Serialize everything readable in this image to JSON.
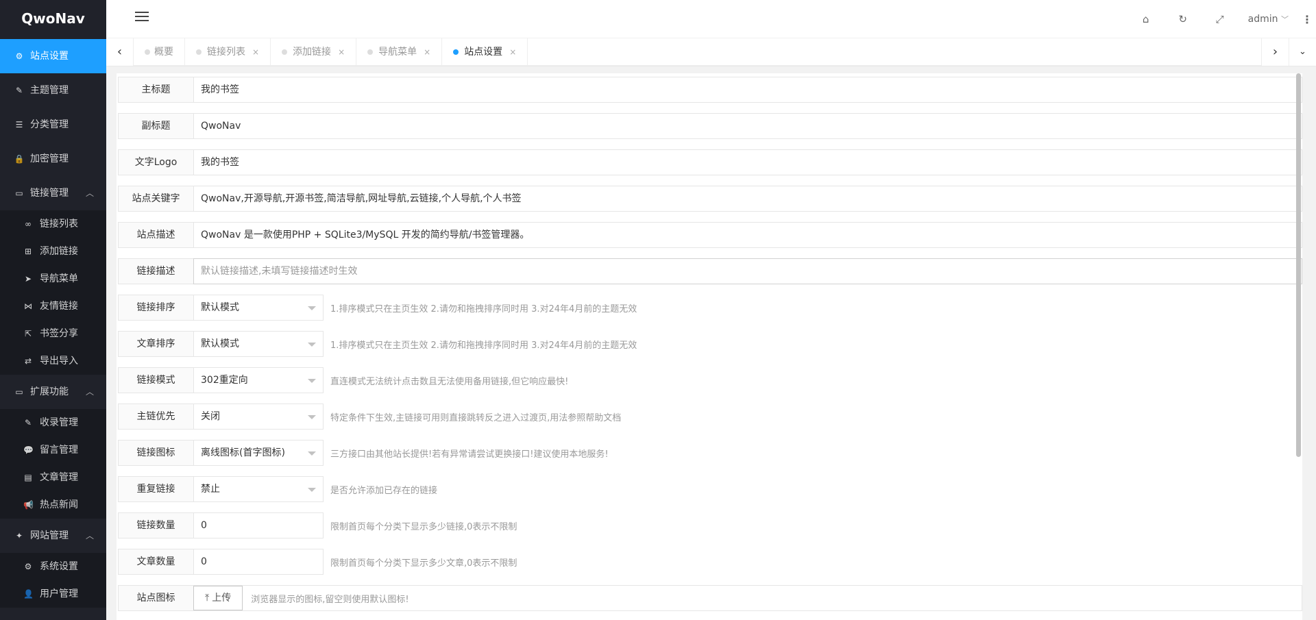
{
  "app": {
    "logo": "QwoNav"
  },
  "sidebar": {
    "items": [
      {
        "label": "站点设置",
        "icon": "⚙"
      },
      {
        "label": "主题管理",
        "icon": "✎"
      },
      {
        "label": "分类管理",
        "icon": "☰"
      },
      {
        "label": "加密管理",
        "icon": "🔒"
      },
      {
        "label": "链接管理",
        "icon": "▭",
        "arrow": "︿"
      },
      {
        "label": "扩展功能",
        "icon": "▭",
        "arrow": "︿"
      },
      {
        "label": "网站管理",
        "icon": "✦",
        "arrow": "︿"
      }
    ],
    "link_children": [
      {
        "label": "链接列表",
        "icon": "∞"
      },
      {
        "label": "添加链接",
        "icon": "⊞"
      },
      {
        "label": "导航菜单",
        "icon": "➤"
      },
      {
        "label": "友情链接",
        "icon": "⋈"
      },
      {
        "label": "书签分享",
        "icon": "⇱"
      },
      {
        "label": "导出导入",
        "icon": "⇄"
      }
    ],
    "ext_children": [
      {
        "label": "收录管理",
        "icon": "✎"
      },
      {
        "label": "留言管理",
        "icon": "💬"
      },
      {
        "label": "文章管理",
        "icon": "▤"
      },
      {
        "label": "热点新闻",
        "icon": "📢"
      }
    ],
    "site_children": [
      {
        "label": "系统设置",
        "icon": "⚙"
      },
      {
        "label": "用户管理",
        "icon": "👤"
      }
    ]
  },
  "header": {
    "home_icon": "⌂",
    "refresh_icon": "↻",
    "fullscreen_icon": "⤢",
    "user": "admin",
    "user_caret": "﹀",
    "more_icon": "⋮"
  },
  "tabs": {
    "prev": "‹",
    "next": "›",
    "down": "⌄",
    "close": "×",
    "items": [
      {
        "label": "概要"
      },
      {
        "label": "链接列表"
      },
      {
        "label": "添加链接"
      },
      {
        "label": "导航菜单"
      },
      {
        "label": "站点设置"
      }
    ]
  },
  "form": {
    "title": {
      "label": "主标题",
      "value": "我的书签"
    },
    "subtitle": {
      "label": "副标题",
      "value": "QwoNav"
    },
    "text_logo": {
      "label": "文字Logo",
      "value": "我的书签"
    },
    "keywords": {
      "label": "站点关键字",
      "value": "QwoNav,开源导航,开源书签,简洁导航,网址导航,云链接,个人导航,个人书签"
    },
    "description": {
      "label": "站点描述",
      "value": "QwoNav 是一款使用PHP + SQLite3/MySQL 开发的简约导航/书签管理器。"
    },
    "link_desc": {
      "label": "链接描述",
      "placeholder": "默认链接描述,未填写链接描述时生效"
    },
    "link_sort": {
      "label": "链接排序",
      "value": "默认模式",
      "aux": "1.排序模式只在主页生效 2.请勿和拖拽排序同时用 3.对24年4月前的主题无效"
    },
    "article_sort": {
      "label": "文章排序",
      "value": "默认模式",
      "aux": "1.排序模式只在主页生效 2.请勿和拖拽排序同时用 3.对24年4月前的主题无效"
    },
    "link_mode": {
      "label": "链接模式",
      "value": "302重定向",
      "aux": "直连模式无法统计点击数且无法使用备用链接,但它响应最快!"
    },
    "main_link": {
      "label": "主链优先",
      "value": "关闭",
      "aux": "特定条件下生效,主链接可用则直接跳转反之进入过渡页,用法参照帮助文档"
    },
    "link_icon": {
      "label": "链接图标",
      "value": "离线图标(首字图标)",
      "aux": "三方接口由其他站长提供!若有异常请尝试更换接口!建议使用本地服务!"
    },
    "dup_link": {
      "label": "重复链接",
      "value": "禁止",
      "aux": "是否允许添加已存在的链接"
    },
    "link_count": {
      "label": "链接数量",
      "value": "0",
      "aux": "限制首页每个分类下显示多少链接,0表示不限制"
    },
    "article_count": {
      "label": "文章数量",
      "value": "0",
      "aux": "限制首页每个分类下显示多少文章,0表示不限制"
    },
    "site_icon": {
      "label": "站点图标",
      "button": "上传",
      "button_icon": "⤒",
      "aux": "浏览器显示的图标,留空则使用默认图标!"
    }
  }
}
